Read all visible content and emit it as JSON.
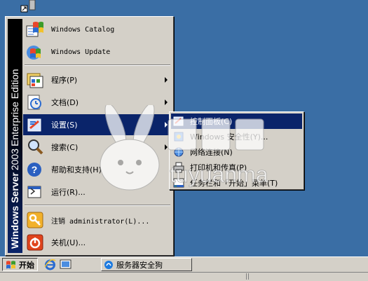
{
  "banner": {
    "brand": "Windows Server",
    "year": "2003",
    "edition": "Enterprise Edition"
  },
  "menu": {
    "top_items": [
      {
        "label": "Windows Catalog",
        "icon": "windows-catalog-icon"
      },
      {
        "label": "Windows Update",
        "icon": "windows-update-icon"
      }
    ],
    "items": [
      {
        "label": "程序(P)",
        "icon": "programs-icon",
        "arrow": true
      },
      {
        "label": "文档(D)",
        "icon": "documents-icon",
        "arrow": true
      },
      {
        "label": "设置(S)",
        "icon": "settings-icon",
        "arrow": true,
        "highlighted": true
      },
      {
        "label": "搜索(C)",
        "icon": "search-icon",
        "arrow": true
      },
      {
        "label": "帮助和支持(H)",
        "icon": "help-icon"
      },
      {
        "label": "运行(R)...",
        "icon": "run-icon"
      }
    ],
    "bottom_items": [
      {
        "label": "注销 administrator(L)...",
        "icon": "logoff-icon"
      },
      {
        "label": "关机(U)...",
        "icon": "shutdown-icon"
      }
    ]
  },
  "submenu": {
    "items": [
      {
        "label": "控制面板(C)",
        "icon": "control-panel-icon",
        "highlighted": true
      },
      {
        "label": "Windows 安全性(Y)...",
        "icon": "windows-security-icon"
      },
      {
        "label": "网络连接(N)",
        "icon": "network-connections-icon"
      },
      {
        "label": "打印机和传真(P)",
        "icon": "printers-icon"
      },
      {
        "label": "任务栏和「开始」菜单(T)",
        "icon": "taskbar-icon"
      }
    ]
  },
  "taskbar": {
    "start_label": "开始",
    "window_button": "服务器安全狗",
    "quick_launch": [
      "ie-icon",
      "desktop-icon"
    ]
  },
  "watermark": {
    "text": "tuyuanma"
  },
  "colors": {
    "desktop": "#3a6ea5",
    "highlight": "#0a246a",
    "face": "#d4d0c8"
  }
}
